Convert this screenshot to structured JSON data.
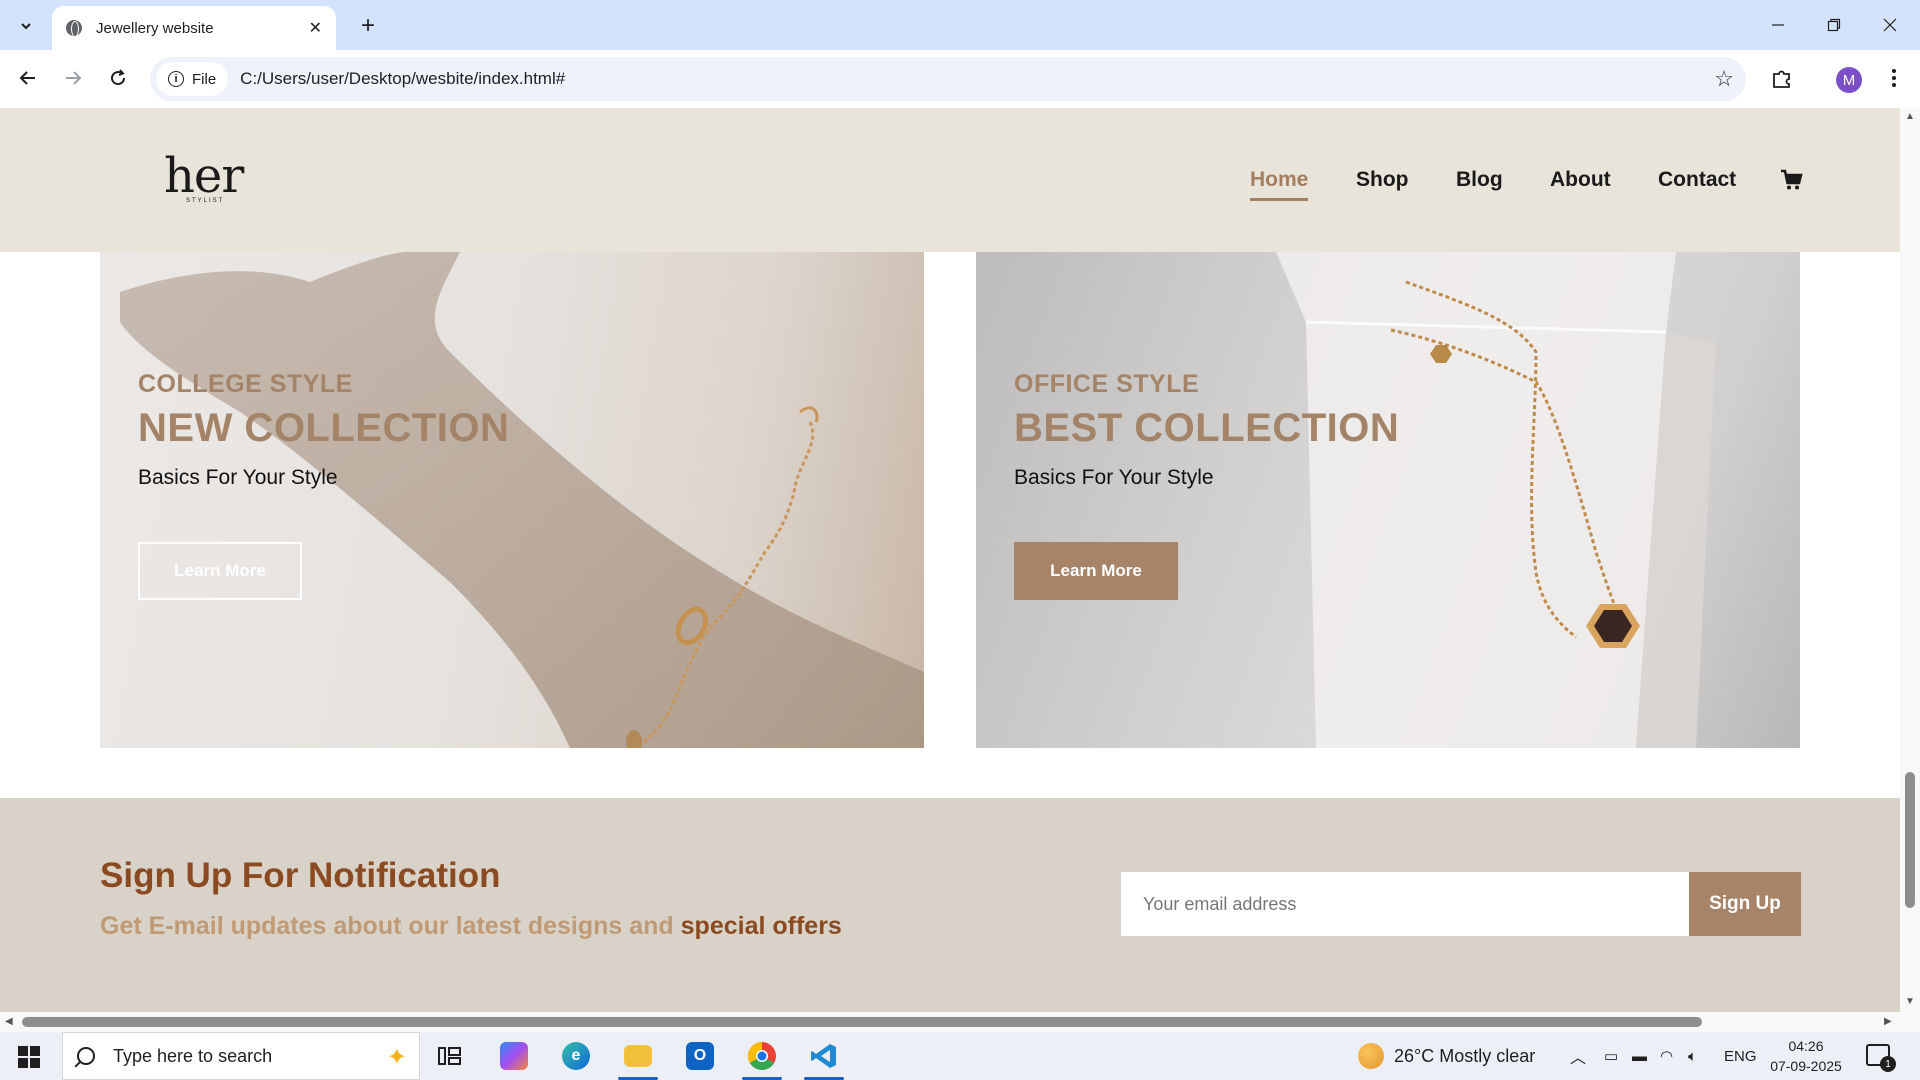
{
  "browser": {
    "tab_title": "Jewellery website",
    "new_tab_label": "+",
    "site_info_label": "File",
    "url": "C:/Users/user/Desktop/wesbite/index.html#",
    "profile_initial": "M"
  },
  "site": {
    "logo_text": "her",
    "logo_sub": "STYLIST",
    "nav": [
      {
        "label": "Home",
        "active": true
      },
      {
        "label": "Shop",
        "active": false
      },
      {
        "label": "Blog",
        "active": false
      },
      {
        "label": "About",
        "active": false
      },
      {
        "label": "Contact",
        "active": false
      }
    ],
    "cart_icon": "cart-icon"
  },
  "banners": [
    {
      "kicker": "COLLEGE STYLE",
      "heading": "NEW COLLECTION",
      "subtext": "Basics For Your Style",
      "button_label": "Learn More",
      "image": "bracelet on wrist shadow"
    },
    {
      "kicker": "OFFICE STYLE",
      "heading": "BEST COLLECTION",
      "subtext": "Basics For Your Style",
      "button_label": "Learn More",
      "image": "gold pendant necklace"
    }
  ],
  "signup": {
    "title": "Sign Up For Notification",
    "subtitle_main": "Get E-mail updates about our latest designs and ",
    "subtitle_emphasis": "special offers",
    "email_placeholder": "Your email address",
    "button_label": "Sign Up"
  },
  "taskbar": {
    "search_placeholder": "Type here to search",
    "weather": "26°C  Mostly clear",
    "language": "ENG",
    "time": "04:26",
    "date": "07-09-2025",
    "notification_count": "1"
  },
  "colors": {
    "accent": "#a78468",
    "header_bg": "#e9e4da",
    "signup_title": "#8b4a1f"
  }
}
